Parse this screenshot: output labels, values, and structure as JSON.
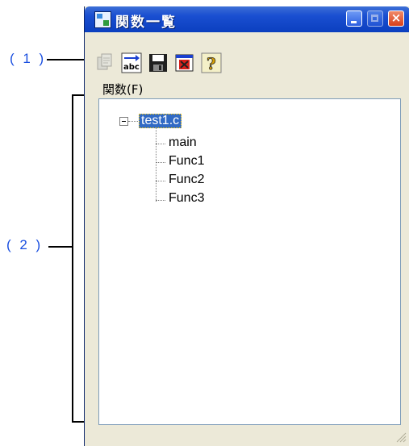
{
  "window": {
    "title": "関数一覧",
    "title_icon": "function-list-app-icon",
    "buttons": [
      "minimize-icon",
      "maximize-icon",
      "close-icon"
    ],
    "title_color": "#0b3fbf"
  },
  "callouts": {
    "toolbar": "( 1 )",
    "tree": "( 2 )"
  },
  "toolbar": {
    "items": [
      {
        "icon": "copy-document-icon",
        "enabled": false
      },
      {
        "icon": "sort-abc-icon",
        "enabled": true
      },
      {
        "icon": "save-floppy-icon",
        "enabled": true
      },
      {
        "icon": "close-window-icon",
        "enabled": true
      },
      {
        "icon": "help-question-icon",
        "enabled": true
      }
    ]
  },
  "tree": {
    "label": "関数(F)",
    "root": {
      "label": "test1.c",
      "expanded": true,
      "selected": true,
      "children": [
        "main",
        "Func1",
        "Func2",
        "Func3"
      ]
    }
  },
  "colors": {
    "selection": "#316ac5",
    "callout": "#1a4fe0"
  }
}
